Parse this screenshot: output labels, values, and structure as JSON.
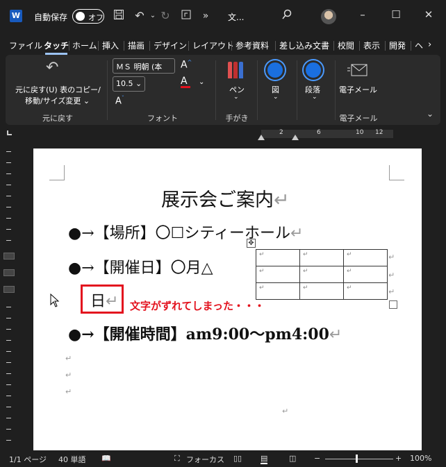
{
  "titlebar": {
    "app_letter": "W",
    "autosave_label": "自動保存",
    "autosave_state": "オフ",
    "doc_title": "文...",
    "more": "»",
    "icons": [
      "save-icon",
      "undo-icon",
      "redo-icon",
      "touch-mode-icon",
      "search-icon",
      "minimize-icon",
      "maximize-icon",
      "close-icon"
    ]
  },
  "tabs": [
    "ファイル",
    "タッチ",
    "ホーム",
    "挿入",
    "描画",
    "デザイン",
    "レイアウト",
    "参考資料",
    "差し込み文書",
    "校閲",
    "表示",
    "開発",
    "ヘ"
  ],
  "active_tab": "タッチ",
  "ribbon": {
    "undo_line1": "元に戻す(U) 表のコピー/",
    "undo_line2": "移動/サイズ変更 ⌄",
    "undo_group": "元に戻す",
    "font_name": "ＭＳ 明朝 (本",
    "font_size": "10.5",
    "font_group": "フォント",
    "pen_label": "ペン",
    "handwriting_group": "手がき",
    "figure_label": "図",
    "paragraph_label": "段落",
    "email_label": "電子メール",
    "email_group": "電子メール"
  },
  "ruler": {
    "numbers": [
      "2",
      "6",
      "10",
      "12"
    ]
  },
  "document": {
    "title": "展示会ご案内",
    "line1": "●→【場所】〇☐シティーホール",
    "line2": "●→【開催日】〇月△",
    "line2_wrap": "日",
    "line3": "●→【開催時間】am9:00～pm4:00",
    "return_mark": "↵",
    "annotation": "文字がずれてしまった・・・",
    "table_rows": 3,
    "table_cols": 3
  },
  "status": {
    "page": "1/1 ページ",
    "words": "40 単語",
    "focus": "フォーカス",
    "zoom": "100%",
    "zoom_minus": "−",
    "zoom_plus": "+"
  },
  "colors": {
    "annotation": "#e3121e",
    "accent": "#185abd",
    "ribbon_bg": "#2b2b2b"
  }
}
